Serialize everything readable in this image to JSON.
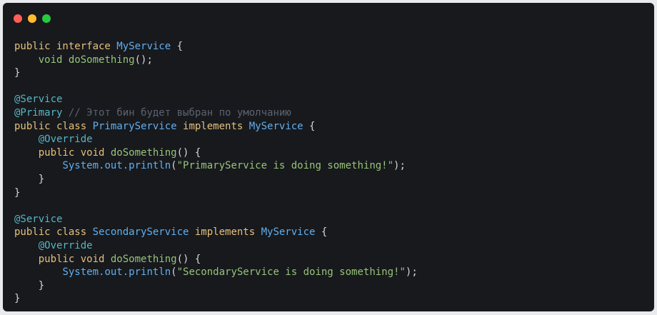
{
  "window": {
    "controls": {
      "close_color": "#ff5f56",
      "minimize_color": "#ffbd2e",
      "maximize_color": "#27c93f"
    }
  },
  "code": {
    "language": "java",
    "lines": [
      [
        {
          "t": "public interface ",
          "c": "kw"
        },
        {
          "t": "MyService",
          "c": "tp"
        },
        {
          "t": " {",
          "c": "pl"
        }
      ],
      [
        {
          "t": "    ",
          "c": "pl"
        },
        {
          "t": "void ",
          "c": "fn"
        },
        {
          "t": "doSomething",
          "c": "fn"
        },
        {
          "t": "();",
          "c": "pl"
        }
      ],
      [
        {
          "t": "}",
          "c": "pl"
        }
      ],
      [],
      [
        {
          "t": "@Service",
          "c": "an"
        }
      ],
      [
        {
          "t": "@Primary",
          "c": "an"
        },
        {
          "t": " // Этот бин будет выбран по умолчанию",
          "c": "cm"
        }
      ],
      [
        {
          "t": "public class ",
          "c": "kw"
        },
        {
          "t": "PrimaryService",
          "c": "tp"
        },
        {
          "t": " implements ",
          "c": "kw"
        },
        {
          "t": "MyService",
          "c": "tp"
        },
        {
          "t": " {",
          "c": "pl"
        }
      ],
      [
        {
          "t": "    ",
          "c": "pl"
        },
        {
          "t": "@Override",
          "c": "an"
        }
      ],
      [
        {
          "t": "    ",
          "c": "pl"
        },
        {
          "t": "public void ",
          "c": "kw"
        },
        {
          "t": "doSomething",
          "c": "fn"
        },
        {
          "t": "() {",
          "c": "pl"
        }
      ],
      [
        {
          "t": "        ",
          "c": "pl"
        },
        {
          "t": "System.out.println",
          "c": "tp"
        },
        {
          "t": "(",
          "c": "pl"
        },
        {
          "t": "\"PrimaryService is doing something!\"",
          "c": "st"
        },
        {
          "t": ");",
          "c": "pl"
        }
      ],
      [
        {
          "t": "    }",
          "c": "pl"
        }
      ],
      [
        {
          "t": "}",
          "c": "pl"
        }
      ],
      [],
      [
        {
          "t": "@Service",
          "c": "an"
        }
      ],
      [
        {
          "t": "public class ",
          "c": "kw"
        },
        {
          "t": "SecondaryService",
          "c": "tp"
        },
        {
          "t": " implements ",
          "c": "kw"
        },
        {
          "t": "MyService",
          "c": "tp"
        },
        {
          "t": " {",
          "c": "pl"
        }
      ],
      [
        {
          "t": "    ",
          "c": "pl"
        },
        {
          "t": "@Override",
          "c": "an"
        }
      ],
      [
        {
          "t": "    ",
          "c": "pl"
        },
        {
          "t": "public void ",
          "c": "kw"
        },
        {
          "t": "doSomething",
          "c": "fn"
        },
        {
          "t": "() {",
          "c": "pl"
        }
      ],
      [
        {
          "t": "        ",
          "c": "pl"
        },
        {
          "t": "System.out.println",
          "c": "tp"
        },
        {
          "t": "(",
          "c": "pl"
        },
        {
          "t": "\"SecondaryService is doing something!\"",
          "c": "st"
        },
        {
          "t": ");",
          "c": "pl"
        }
      ],
      [
        {
          "t": "    }",
          "c": "pl"
        }
      ],
      [
        {
          "t": "}",
          "c": "pl"
        }
      ]
    ]
  }
}
